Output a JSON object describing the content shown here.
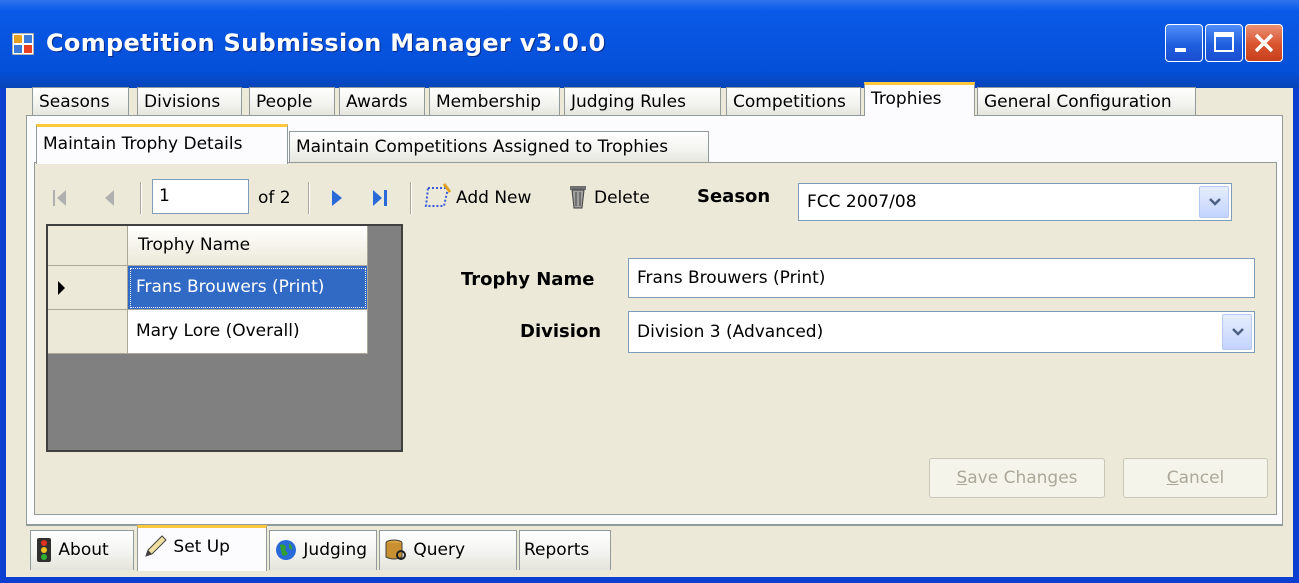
{
  "window": {
    "title": "Competition Submission Manager v3.0.0",
    "icon": "app-grid-icon",
    "controls": [
      "minimize-icon",
      "maximize-icon",
      "close-icon"
    ]
  },
  "main_tabs": [
    "Seasons",
    "Divisions",
    "People",
    "Awards",
    "Membership",
    "Judging Rules",
    "Competitions",
    "Trophies",
    "General Configuration"
  ],
  "main_tab_active": "Trophies",
  "sub_tabs": [
    "Maintain Trophy Details",
    "Maintain Competitions Assigned to Trophies"
  ],
  "sub_tab_active": "Maintain Trophy Details",
  "navigator": {
    "position": "1",
    "count_label": "of 2",
    "add_new_label": "Add New",
    "delete_label": "Delete"
  },
  "season": {
    "label": "Season",
    "value": "FCC 2007/08"
  },
  "grid": {
    "header": "Trophy Name",
    "rows": [
      "Frans Brouwers (Print)",
      "Mary Lore (Overall)"
    ],
    "selected_index": 0
  },
  "form": {
    "trophy_name_label": "Trophy Name",
    "trophy_name_value": "Frans Brouwers (Print)",
    "division_label": "Division",
    "division_value": "Division 3 (Advanced)"
  },
  "buttons": {
    "save_pre": "",
    "save_key": "S",
    "save_rest": "ave Changes",
    "cancel_key": "C",
    "cancel_rest": "ancel"
  },
  "bottom_tabs": [
    {
      "label": "About",
      "icon": "traffic-light-icon"
    },
    {
      "label": "Set Up",
      "icon": "pencil-icon"
    },
    {
      "label": "Judging",
      "icon": "globe-icon"
    },
    {
      "label": "Query",
      "icon": "database-icon"
    },
    {
      "label": "Reports",
      "icon": ""
    }
  ],
  "bottom_tab_active": "Set Up",
  "colors": {
    "titlebar": "#0754e0",
    "selection": "#316ac5",
    "active_tab_accent": "#ffc83c"
  }
}
